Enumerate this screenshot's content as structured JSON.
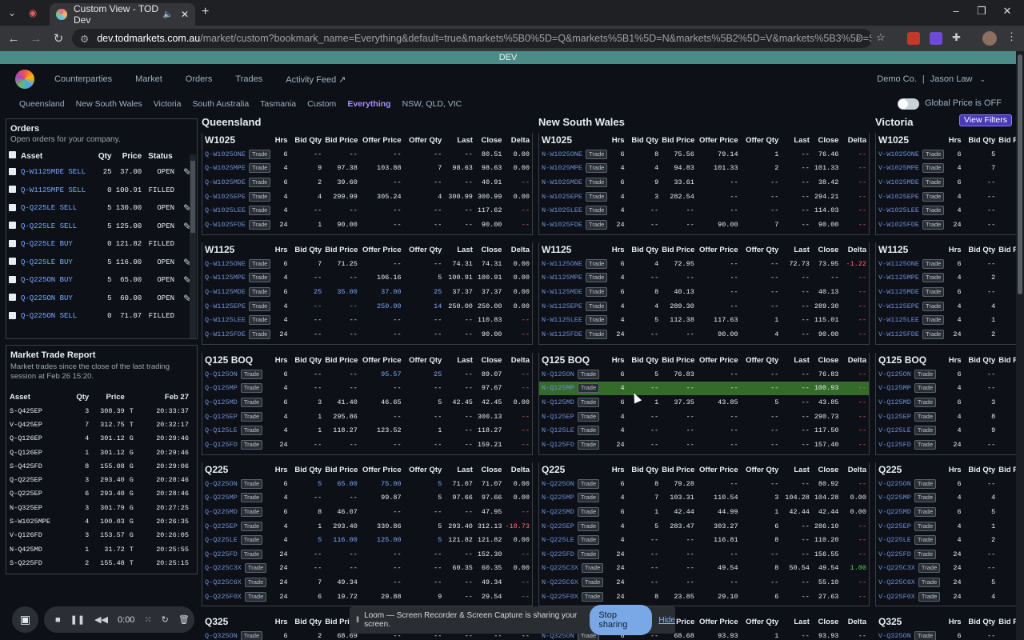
{
  "browser": {
    "tab_title": "Custom View - TOD Dev",
    "url_host": "dev.todmarkets.com.au",
    "url_rest": "/market/custom?bookmark_name=Everything&default=true&markets%5B0%5D=Q&markets%5B1%5D=N&markets%5B2%5D=V&markets%5B3%5D=S&markets%5B4%5D=T..."
  },
  "env_banner": "DEV",
  "nav": {
    "items": [
      "Counterparties",
      "Market",
      "Orders",
      "Trades",
      "Activity Feed"
    ],
    "company": "Demo Co.",
    "separator": "|",
    "user": "Jason Law"
  },
  "regions": [
    "Queensland",
    "New South Wales",
    "Victoria",
    "South Australia",
    "Tasmania",
    "Custom",
    "Everything",
    "NSW, QLD, VIC"
  ],
  "global_price_label": "Global Price is OFF",
  "view_filters": "View Filters",
  "orders": {
    "title": "Orders",
    "subtitle": "Open orders for your company.",
    "headers": [
      "Asset",
      "Qty",
      "Price",
      "Status"
    ],
    "rows": [
      [
        "Q-W1125MDE SELL",
        "25",
        "37.00",
        "OPEN"
      ],
      [
        "Q-W1125MPE SELL",
        "0",
        "100.91",
        "FILLED"
      ],
      [
        "Q-Q225LE SELL",
        "5",
        "130.00",
        "OPEN"
      ],
      [
        "Q-Q225LE SELL",
        "5",
        "125.00",
        "OPEN"
      ],
      [
        "Q-Q225LE BUY",
        "0",
        "121.82",
        "FILLED"
      ],
      [
        "Q-Q225LE BUY",
        "5",
        "116.00",
        "OPEN"
      ],
      [
        "Q-Q225ON BUY",
        "5",
        "65.00",
        "OPEN"
      ],
      [
        "Q-Q225ON BUY",
        "5",
        "60.00",
        "OPEN"
      ],
      [
        "Q-Q225ON SELL",
        "0",
        "71.07",
        "FILLED"
      ]
    ]
  },
  "trade_report": {
    "title": "Market Trade Report",
    "subtitle": "Market trades since the close of the last trading session at Feb 26 15:20.",
    "headers": [
      "Asset",
      "Qty",
      "Price",
      "Feb 27"
    ],
    "rows": [
      [
        "S-Q425EP",
        "3",
        "308.39",
        "T",
        "20:33:37"
      ],
      [
        "V-Q425EP",
        "7",
        "312.75",
        "T",
        "20:32:17"
      ],
      [
        "Q-Q126EP",
        "4",
        "301.12",
        "G",
        "20:29:46"
      ],
      [
        "Q-Q126EP",
        "1",
        "301.12",
        "G",
        "20:29:46"
      ],
      [
        "S-Q425FD",
        "8",
        "155.08",
        "G",
        "20:29:06"
      ],
      [
        "Q-Q225EP",
        "3",
        "293.40",
        "G",
        "20:28:46"
      ],
      [
        "Q-Q225EP",
        "6",
        "293.40",
        "G",
        "20:28:46"
      ],
      [
        "N-Q325EP",
        "3",
        "301.79",
        "G",
        "20:27:25"
      ],
      [
        "S-W1025MPE",
        "4",
        "100.03",
        "G",
        "20:26:35"
      ],
      [
        "V-Q126FD",
        "3",
        "153.57",
        "G",
        "20:26:05"
      ],
      [
        "N-Q425MD",
        "1",
        "31.72",
        "T",
        "20:25:55"
      ],
      [
        "S-Q225FD",
        "2",
        "155.48",
        "T",
        "20:25:15"
      ]
    ]
  },
  "market_headers": [
    "Hrs",
    "Bid Qty",
    "Bid Price",
    "Offer Price",
    "Offer Qty",
    "Last",
    "Close",
    "Delta"
  ],
  "trade_label": "Trade",
  "market_regions": [
    {
      "name": "Queensland",
      "groups": [
        {
          "name": "W1025",
          "rows": [
            [
              "Q-W1025ONE",
              "6",
              "--",
              "--",
              "--",
              "--",
              "--",
              "80.51",
              "0.00"
            ],
            [
              "Q-W1025MPE",
              "4",
              "9",
              "97.38",
              "103.88",
              "7",
              "98.63",
              "98.63",
              "0.00"
            ],
            [
              "Q-W1025MDE",
              "6",
              "2",
              "39.60",
              "--",
              "--",
              "--",
              "40.91",
              "--"
            ],
            [
              "Q-W1025EPE",
              "4",
              "4",
              "299.99",
              "305.24",
              "4",
              "300.99",
              "300.99",
              "0.00"
            ],
            [
              "Q-W1025LEE",
              "4",
              "--",
              "--",
              "--",
              "--",
              "--",
              "117.62",
              "--"
            ],
            [
              "Q-W1025FDE",
              "24",
              "1",
              "90.00",
              "--",
              "--",
              "--",
              "90.00",
              "--"
            ]
          ]
        },
        {
          "name": "W1125",
          "rows": [
            [
              "Q-W1125ONE",
              "6",
              "7",
              "71.25",
              "--",
              "--",
              "74.31",
              "74.31",
              "0.00"
            ],
            [
              "Q-W1125MPE",
              "4",
              "--",
              "--",
              "106.16",
              "5",
              "100.91",
              "100.91",
              "0.00"
            ],
            [
              "Q-W1125MDE",
              "6",
              "25",
              "35.00",
              "37.00",
              "25",
              "37.37",
              "37.37",
              "0.00"
            ],
            [
              "Q-W1125EPE",
              "4",
              "--",
              "--",
              "250.00",
              "14",
              "250.00",
              "250.00",
              "0.00"
            ],
            [
              "Q-W1125LEE",
              "4",
              "--",
              "--",
              "--",
              "--",
              "--",
              "110.83",
              "--"
            ],
            [
              "Q-W1125FDE",
              "24",
              "--",
              "--",
              "--",
              "--",
              "--",
              "90.00",
              "--"
            ]
          ]
        },
        {
          "name": "Q125 BOQ",
          "rows": [
            [
              "Q-Q125ON",
              "6",
              "--",
              "--",
              "95.57",
              "25",
              "--",
              "89.07",
              "--"
            ],
            [
              "Q-Q125MP",
              "4",
              "--",
              "--",
              "--",
              "--",
              "--",
              "97.67",
              "--"
            ],
            [
              "Q-Q125MD",
              "6",
              "3",
              "41.40",
              "46.65",
              "5",
              "42.45",
              "42.45",
              "0.00"
            ],
            [
              "Q-Q125EP",
              "4",
              "1",
              "295.86",
              "--",
              "--",
              "--",
              "300.13",
              "--"
            ],
            [
              "Q-Q125LE",
              "4",
              "1",
              "118.27",
              "123.52",
              "1",
              "--",
              "118.27",
              "--"
            ],
            [
              "Q-Q125FD",
              "24",
              "--",
              "--",
              "--",
              "--",
              "--",
              "159.21",
              "--"
            ]
          ]
        },
        {
          "name": "Q225",
          "rows": [
            [
              "Q-Q225ON",
              "6",
              "5",
              "65.00",
              "75.00",
              "5",
              "71.07",
              "71.07",
              "0.00"
            ],
            [
              "Q-Q225MP",
              "4",
              "--",
              "--",
              "99.87",
              "5",
              "97.66",
              "97.66",
              "0.00"
            ],
            [
              "Q-Q225MD",
              "6",
              "8",
              "46.07",
              "--",
              "--",
              "--",
              "47.95",
              "--"
            ],
            [
              "Q-Q225EP",
              "4",
              "1",
              "293.40",
              "330.86",
              "5",
              "293.40",
              "312.13",
              "-18.73"
            ],
            [
              "Q-Q225LE",
              "4",
              "5",
              "116.00",
              "125.00",
              "5",
              "121.82",
              "121.82",
              "0.00"
            ],
            [
              "Q-Q225FD",
              "24",
              "--",
              "--",
              "--",
              "--",
              "--",
              "152.30",
              "--"
            ],
            [
              "Q-Q225C3X",
              "24",
              "--",
              "--",
              "--",
              "--",
              "60.35",
              "60.35",
              "0.00"
            ],
            [
              "Q-Q225C6X",
              "24",
              "7",
              "49.34",
              "--",
              "--",
              "--",
              "49.34",
              "--"
            ],
            [
              "Q-Q225F0X",
              "24",
              "6",
              "19.72",
              "29.88",
              "9",
              "--",
              "29.54",
              "--"
            ]
          ]
        }
      ]
    },
    {
      "name": "New South Wales",
      "groups": [
        {
          "name": "W1025",
          "rows": [
            [
              "N-W1025ONE",
              "6",
              "8",
              "75.56",
              "79.14",
              "1",
              "--",
              "76.46",
              "--"
            ],
            [
              "N-W1025MPE",
              "4",
              "4",
              "94.83",
              "101.33",
              "2",
              "--",
              "101.33",
              "--"
            ],
            [
              "N-W1025MDE",
              "6",
              "9",
              "33.61",
              "--",
              "--",
              "--",
              "38.42",
              "--"
            ],
            [
              "N-W1025EPE",
              "4",
              "3",
              "282.54",
              "--",
              "--",
              "--",
              "294.21",
              "--"
            ],
            [
              "N-W1025LEE",
              "4",
              "--",
              "--",
              "--",
              "--",
              "--",
              "114.03",
              "--"
            ],
            [
              "N-W1025FDE",
              "24",
              "--",
              "--",
              "90.00",
              "7",
              "--",
              "90.00",
              "--"
            ]
          ]
        },
        {
          "name": "W1125",
          "rows": [
            [
              "N-W1125ONE",
              "6",
              "4",
              "72.95",
              "--",
              "--",
              "72.73",
              "73.95",
              "-1.22"
            ],
            [
              "N-W1125MPE",
              "4",
              "--",
              "--",
              "--",
              "--",
              "--",
              "--",
              "--"
            ],
            [
              "N-W1125MDE",
              "6",
              "8",
              "40.13",
              "--",
              "--",
              "--",
              "40.13",
              "--"
            ],
            [
              "N-W1125EPE",
              "4",
              "4",
              "289.30",
              "--",
              "--",
              "--",
              "289.30",
              "--"
            ],
            [
              "N-W1125LEE",
              "4",
              "5",
              "112.38",
              "117.63",
              "1",
              "--",
              "115.01",
              "--"
            ],
            [
              "N-W1125FDE",
              "24",
              "--",
              "--",
              "90.00",
              "4",
              "--",
              "90.00",
              "--"
            ]
          ]
        },
        {
          "name": "Q125 BOQ",
          "rows": [
            [
              "N-Q125ON",
              "6",
              "5",
              "76.83",
              "--",
              "--",
              "--",
              "76.83",
              "--"
            ],
            [
              "N-Q125MP",
              "4",
              "--",
              "--",
              "--",
              "--",
              "--",
              "100.93",
              "--"
            ],
            [
              "N-Q125MD",
              "6",
              "1",
              "37.35",
              "43.85",
              "5",
              "--",
              "43.85",
              "--"
            ],
            [
              "N-Q125EP",
              "4",
              "--",
              "--",
              "--",
              "--",
              "--",
              "290.73",
              "--"
            ],
            [
              "N-Q125LE",
              "4",
              "--",
              "--",
              "--",
              "--",
              "--",
              "117.50",
              "--"
            ],
            [
              "N-Q125FD",
              "24",
              "--",
              "--",
              "--",
              "--",
              "--",
              "157.40",
              "--"
            ]
          ]
        },
        {
          "name": "Q225",
          "rows": [
            [
              "N-Q225ON",
              "6",
              "8",
              "79.28",
              "--",
              "--",
              "--",
              "80.92",
              "--"
            ],
            [
              "N-Q225MP",
              "4",
              "7",
              "103.31",
              "110.54",
              "3",
              "104.28",
              "104.28",
              "0.00"
            ],
            [
              "N-Q225MD",
              "6",
              "1",
              "42.44",
              "44.99",
              "1",
              "42.44",
              "42.44",
              "0.00"
            ],
            [
              "N-Q225EP",
              "4",
              "5",
              "283.47",
              "303.27",
              "6",
              "--",
              "286.10",
              "--"
            ],
            [
              "N-Q225LE",
              "4",
              "--",
              "--",
              "116.81",
              "8",
              "--",
              "110.20",
              "--"
            ],
            [
              "N-Q225FD",
              "24",
              "--",
              "--",
              "--",
              "--",
              "--",
              "156.55",
              "--"
            ],
            [
              "N-Q225C3X",
              "24",
              "--",
              "--",
              "49.54",
              "8",
              "50.54",
              "49.54",
              "1.00"
            ],
            [
              "N-Q225C6X",
              "24",
              "--",
              "--",
              "--",
              "--",
              "--",
              "55.10",
              "--"
            ],
            [
              "N-Q225F0X",
              "24",
              "8",
              "23.85",
              "29.10",
              "6",
              "--",
              "27.63",
              "--"
            ]
          ]
        }
      ]
    },
    {
      "name": "Victoria",
      "groups": [
        {
          "name": "W1025",
          "rows": [
            [
              "V-W1025ONE",
              "6",
              "5"
            ],
            [
              "V-W1025MPE",
              "4",
              "7"
            ],
            [
              "V-W1025MDE",
              "6",
              "--"
            ],
            [
              "V-W1025EPE",
              "4",
              "--"
            ],
            [
              "V-W1025LEE",
              "4",
              "--"
            ],
            [
              "V-W1025FDE",
              "24",
              "--"
            ]
          ]
        },
        {
          "name": "W1125",
          "rows": [
            [
              "V-W1125ONE",
              "6",
              "--"
            ],
            [
              "V-W1125MPE",
              "4",
              "2"
            ],
            [
              "V-W1125MDE",
              "6",
              "--"
            ],
            [
              "V-W1125EPE",
              "4",
              "4"
            ],
            [
              "V-W1125LEE",
              "4",
              "1"
            ],
            [
              "V-W1125FDE",
              "24",
              "2"
            ]
          ]
        },
        {
          "name": "Q125 BOQ",
          "rows": [
            [
              "V-Q125ON",
              "6",
              "--"
            ],
            [
              "V-Q125MP",
              "4",
              "--"
            ],
            [
              "V-Q125MD",
              "6",
              "3"
            ],
            [
              "V-Q125EP",
              "4",
              "8"
            ],
            [
              "V-Q125LE",
              "4",
              "9"
            ],
            [
              "V-Q125FD",
              "24",
              "--"
            ]
          ]
        },
        {
          "name": "Q225",
          "rows": [
            [
              "V-Q225ON",
              "6",
              "--"
            ],
            [
              "V-Q225MP",
              "4",
              "4"
            ],
            [
              "V-Q225MD",
              "6",
              "5"
            ],
            [
              "V-Q225EP",
              "4",
              "1"
            ],
            [
              "V-Q225LE",
              "4",
              "2"
            ],
            [
              "V-Q225FD",
              "24",
              "--"
            ],
            [
              "V-Q225C3X",
              "24",
              "--"
            ],
            [
              "V-Q225C6X",
              "24",
              "5"
            ],
            [
              "V-Q225F0X",
              "24",
              "4"
            ]
          ]
        }
      ]
    }
  ],
  "q325": {
    "name": "Q325",
    "rows": [
      [
        "Q-Q325ON",
        "6",
        "2",
        "68.69",
        "--",
        "--",
        "--",
        "--",
        "--"
      ],
      [
        "N-Q325ON",
        "6",
        "--",
        "68.68",
        "93.93",
        "1",
        "--",
        "93.93",
        "--"
      ],
      [
        "V-Q325ON",
        "6",
        "--"
      ]
    ]
  },
  "recorder": {
    "time": "0:00"
  },
  "loom": {
    "message": "Loom — Screen Recorder & Screen Capture is sharing your screen.",
    "stop": "Stop sharing",
    "hide": "Hide"
  }
}
